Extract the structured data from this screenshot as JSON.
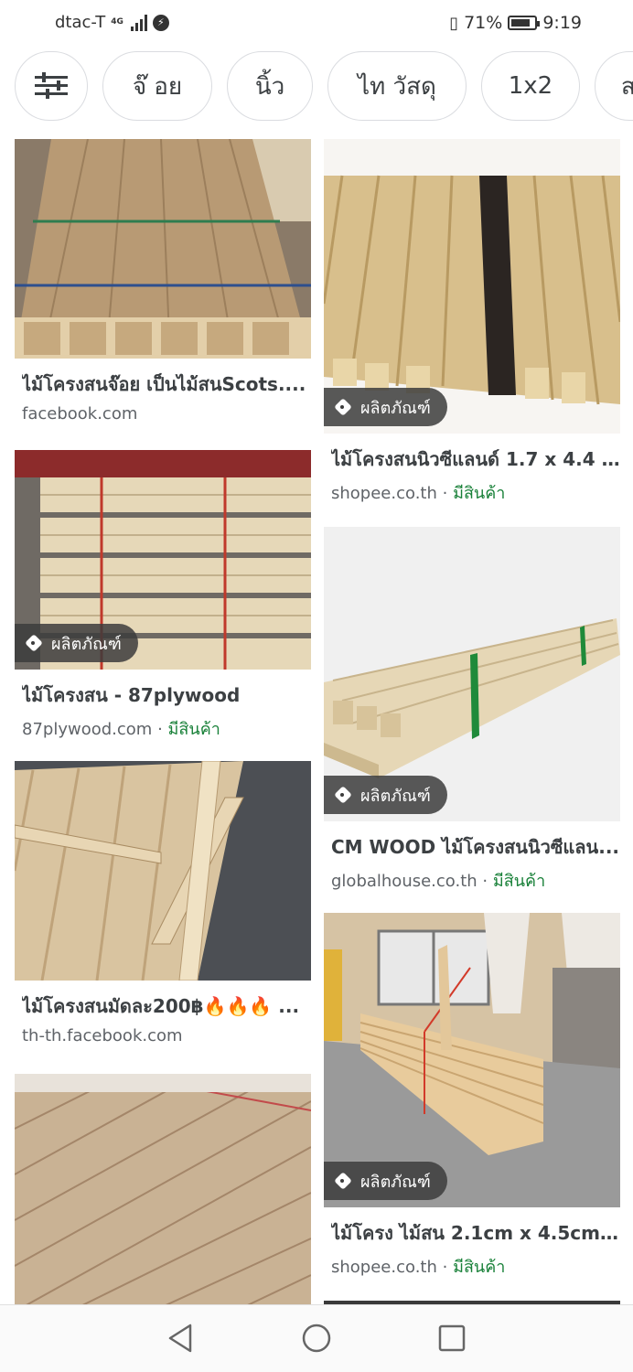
{
  "status_bar": {
    "carrier": "dtac-T",
    "network": "4G",
    "battery": "71%",
    "time": "9:19"
  },
  "chips": [
    {
      "label": "จ๊ อย"
    },
    {
      "label": "นิ้ว"
    },
    {
      "label": "ไท วัสดุ"
    },
    {
      "label": "1x2"
    },
    {
      "label": "ส"
    }
  ],
  "results": [
    {
      "title": "ไม้โครงสนจ๊อย เป็นไม้สนScots....",
      "source": "facebook.com",
      "badge": "",
      "stock": ""
    },
    {
      "title": "ไม้โครงสนนิวซีแลนด์ 1.7 x 4.4 ...",
      "source": "shopee.co.th",
      "badge": "ผลิตภัณฑ์",
      "stock": "มีสินค้า"
    },
    {
      "title": "ไม้โครงสน - 87plywood",
      "source": "87plywood.com",
      "badge": "ผลิตภัณฑ์",
      "stock": "มีสินค้า"
    },
    {
      "title": "CM WOOD ไม้โครงสนนิวซีแลน...",
      "source": "globalhouse.co.th",
      "badge": "ผลิตภัณฑ์",
      "stock": "มีสินค้า"
    },
    {
      "title": "ไม้โครงสนมัดละ200฿🔥🔥🔥 ...",
      "source": "th-th.facebook.com",
      "badge": "",
      "stock": ""
    },
    {
      "title": "ไม้โครง ไม้สน 2.1cm x 4.5cm ...",
      "source": "shopee.co.th",
      "badge": "ผลิตภัณฑ์",
      "stock": "มีสินค้า"
    }
  ],
  "separator": "·"
}
